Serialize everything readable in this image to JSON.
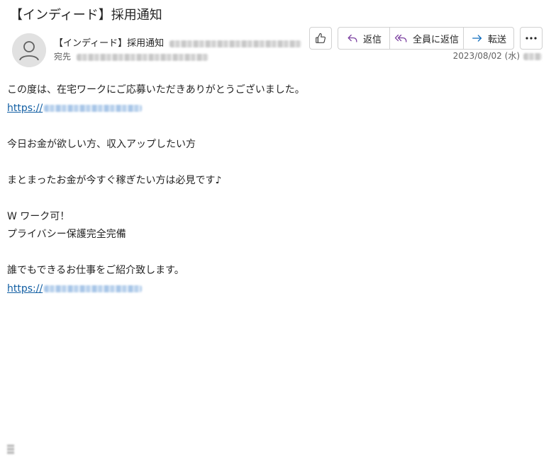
{
  "message": {
    "subject": "【インディード】採用通知",
    "sender_name": "【インディード】採用通知",
    "to_label": "宛先",
    "date": "2023/08/02 (水)"
  },
  "toolbar": {
    "like_icon": "thumbs-up-icon",
    "reply_label": "返信",
    "reply_all_label": "全員に返信",
    "forward_label": "転送",
    "more_icon": "more-icon",
    "accent_reply": "#7b3fa0",
    "accent_forward": "#0f6cbd"
  },
  "body": {
    "line1": "この度は、在宅ワークにご応募いただきありがとうございました。",
    "link1": "https://",
    "line3": "今日お金が欲しい方、収入アップしたい方",
    "line5": "まとまったお金が今すぐ稼ぎたい方は必見です♪",
    "line7": "W ワーク可！",
    "line8": "プライバシー保護完全完備",
    "line10": "誰でもできるお仕事をご紹介致します。",
    "link2": "https://"
  }
}
